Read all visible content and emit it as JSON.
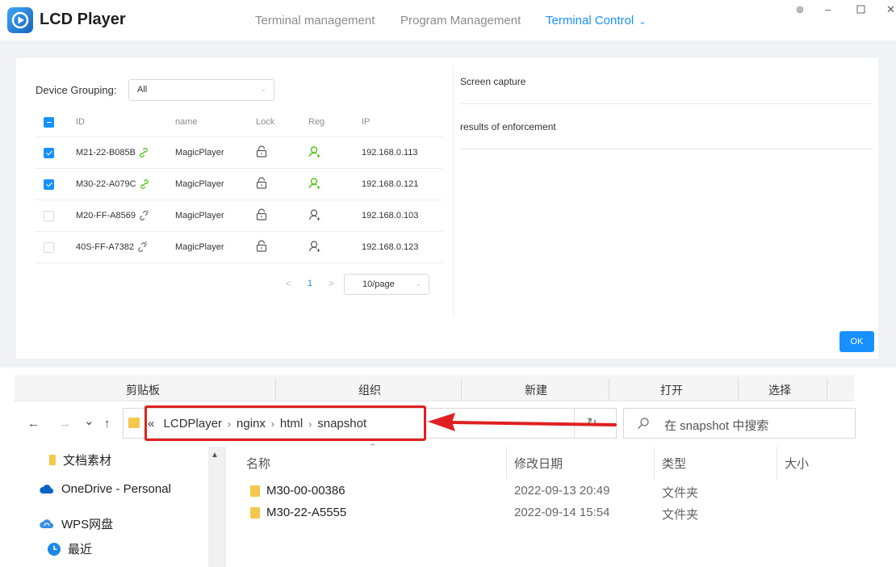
{
  "app": {
    "title": "LCD Player",
    "nav": [
      {
        "label": "Terminal management",
        "active": false
      },
      {
        "label": "Program Management",
        "active": false
      },
      {
        "label": "Terminal Control",
        "active": true
      }
    ],
    "window_controls": [
      "settings-icon",
      "minimize-icon",
      "maximize-icon",
      "close-icon"
    ]
  },
  "device_panel": {
    "grouping_label": "Device Grouping:",
    "grouping_value": "All",
    "columns": [
      "ID",
      "name",
      "Lock",
      "Reg",
      "IP"
    ],
    "rows": [
      {
        "id": "M21-22-B085B",
        "name": "MagicPlayer",
        "ip": "192.168.0.113",
        "checked": true,
        "connected": true,
        "registered": true
      },
      {
        "id": "M30-22-A079C",
        "name": "MagicPlayer",
        "ip": "192.168.0.121",
        "checked": true,
        "connected": true,
        "registered": true
      },
      {
        "id": "M20-FF-A8569",
        "name": "MagicPlayer",
        "ip": "192.168.0.103",
        "checked": false,
        "connected": false,
        "registered": false
      },
      {
        "id": "40S-FF-A7382",
        "name": "MagicPlayer",
        "ip": "192.168.0.123",
        "checked": false,
        "connected": false,
        "registered": false
      }
    ],
    "pagination": {
      "prev": "<",
      "page": "1",
      "next": ">",
      "page_size": "10/page"
    },
    "right": {
      "screen_capture": "Screen capture",
      "results": "results of enforcement"
    },
    "ok_label": "OK",
    "colors": {
      "accent": "#1890ff",
      "connected": "#52c41a",
      "inactive": "#595959"
    }
  },
  "explorer": {
    "ribbon": [
      "剪贴板",
      "组织",
      "新建",
      "打开",
      "选择"
    ],
    "nav_buttons": {
      "back": "←",
      "forward": "→",
      "recent": "⌄",
      "up": "↑"
    },
    "address": {
      "overflow": "«",
      "segments": [
        "LCDPlayer",
        "nginx",
        "html",
        "snapshot"
      ],
      "separator": "›",
      "dropdown": "⌄",
      "refresh": "↻"
    },
    "search_placeholder": "在 snapshot 中搜索",
    "sidebar": [
      {
        "label": "文档素材",
        "icon": "folder-icon"
      },
      {
        "label": "OneDrive - Personal",
        "icon": "cloud-icon"
      },
      {
        "label": "WPS网盘",
        "icon": "wps-cloud-icon"
      },
      {
        "label": "最近",
        "icon": "recent-icon"
      }
    ],
    "columns": [
      "名称",
      "修改日期",
      "类型",
      "大小"
    ],
    "files": [
      {
        "name": "M30-00-00386",
        "modified": "2022-09-13 20:49",
        "type": "文件夹"
      },
      {
        "name": "M30-22-A5555",
        "modified": "2022-09-14 15:54",
        "type": "文件夹"
      }
    ],
    "annotation_color": "#e02020"
  }
}
